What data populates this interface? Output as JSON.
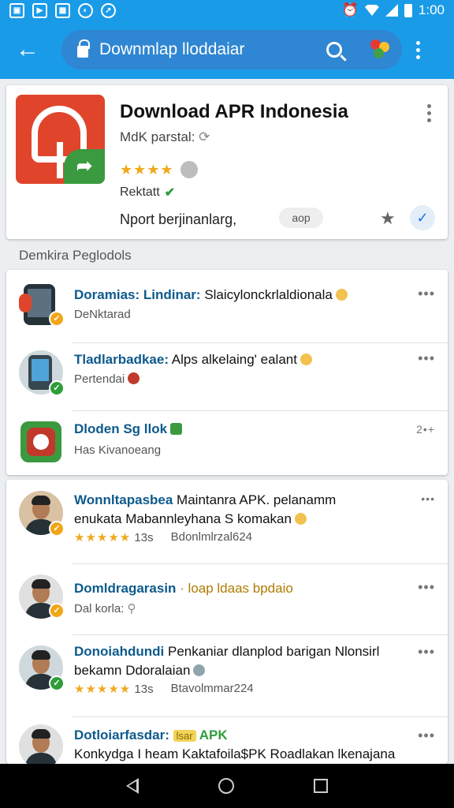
{
  "status_bar": {
    "time": "1:00",
    "left_icons": [
      "notification-icon",
      "mail-icon",
      "photo-icon",
      "chat-icon",
      "compass-icon"
    ],
    "right_icons": [
      "alarm-icon",
      "wifi-icon",
      "signal-icon",
      "battery-icon"
    ]
  },
  "app_bar": {
    "search_text": "Downmlap lloddaiar",
    "icons": [
      "back-arrow-icon",
      "lock-icon",
      "search-icon",
      "profile-icon",
      "more-vert-icon"
    ]
  },
  "featured": {
    "title": "Download APR Indonesia",
    "subtitle": "MdK parstal:",
    "stars": "★★★★",
    "developer": "Rektatt",
    "description": "Nport berjinanlarg,",
    "chip": "aop",
    "colors": {
      "icon_bg": "#e0452c",
      "badge": "#3b9a3f",
      "stars": "#f0a81c"
    }
  },
  "section_label": "Demkira Peglodols",
  "list1": [
    {
      "title_bold": "Doramias: Lindinar:",
      "title_rest": " Slaicylonckrlaldionala",
      "sub": "DeNktarad",
      "more": "•••",
      "badge": "orange"
    },
    {
      "title_bold": "Tladlarbadkae:",
      "title_rest": " Alps alkelaing' ealant",
      "sub": "Pertendai",
      "more": "•••",
      "badge": "green"
    },
    {
      "title_bold": "Dloden Sg llok",
      "title_rest": "",
      "sub": "Has Kivanoeang",
      "more": "2•+",
      "badge": ""
    }
  ],
  "list2": [
    {
      "title_bold": "Wonnltapasbea",
      "title_rest": " Maintanra APK. pelanamm",
      "line2": "enukata Mabannleyhana S komakan",
      "stars": "★★★★★",
      "rating": "13s",
      "date": "Bdonlmlrzal624",
      "more": "•••",
      "badge": "orange"
    },
    {
      "title_bold": "Domldragarasin",
      "title_rest": " · loap ldaas bpdaio",
      "sub": "Dal korla:",
      "more": "•••",
      "badge": "orange"
    },
    {
      "title_bold": "Donoiahdundi",
      "title_rest": " Penkaniar dlanplod barigan Nlonsirl",
      "line2": "bekamn Ddoralaian",
      "stars": "★★★★★",
      "rating": "13s",
      "date": "Btavolmmar224",
      "more": "•••",
      "badge": "green"
    },
    {
      "title_bold": "Dotloiarfasdar:",
      "title_rest": " APK",
      "line2": "Konkydga I heam Kaktafoila$PK Roadlakan lkenajana",
      "more": "•••",
      "badge": "green",
      "apk_tag": "lsar"
    }
  ],
  "nav": [
    "back-icon",
    "home-icon",
    "recents-icon"
  ]
}
